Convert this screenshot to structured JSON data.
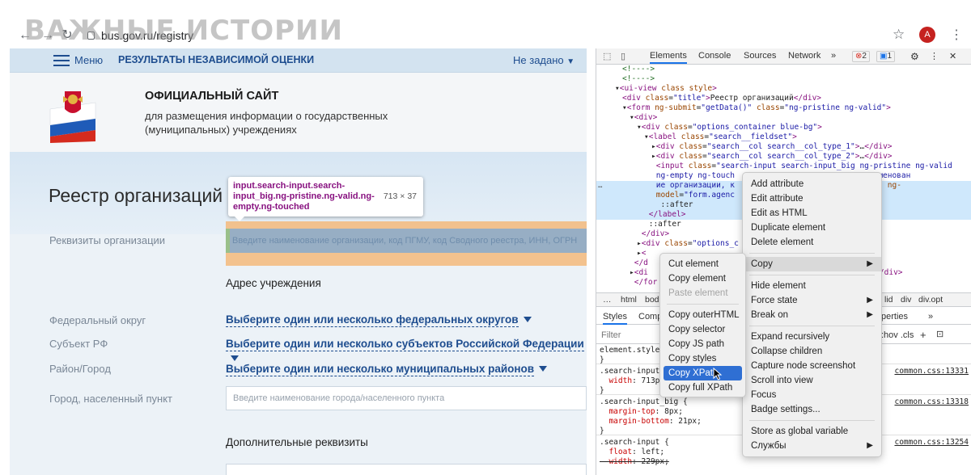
{
  "watermark": "ВАЖНЫЕ ИСТОРИИ",
  "browser": {
    "url": "bus.gov.ru/registry",
    "avatar_letter": "A"
  },
  "site": {
    "nav": {
      "menu_label": "Меню",
      "link": "РЕЗУЛЬТАТЫ НЕЗАВИСИМОЙ ОЦЕНКИ",
      "region": "Не задано"
    },
    "header": {
      "title": "ОФИЦИАЛЬНЫЙ САЙТ",
      "subtitle": "для размещения информации о государственных (муниципальных) учреждениях"
    },
    "page_title": "Реестр организаций",
    "form": {
      "requisites_label": "Реквизиты организации",
      "search_placeholder": "Введите наименование организации, код ПГМУ, код Сводного реестра, ИНН, ОГРН",
      "address_title": "Адрес учреждения",
      "district_label": "Федеральный округ",
      "district_value": "Выберите один или несколько федеральных округов",
      "subject_label": "Субъект РФ",
      "subject_value": "Выберите один или несколько субъектов Российской Федерации",
      "area_label": "Район/Город",
      "area_value": "Выберите один или несколько муниципальных районов",
      "city_label": "Город, населенный пункт",
      "city_placeholder": "Введите наименование города/населенного пункта",
      "extra_title": "Дополнительные реквизиты"
    },
    "tooltip": {
      "selector": "input.search-input.search-input_big.ng-pristine.ng-valid.ng-empty.ng-touched",
      "size": "713 × 37"
    }
  },
  "devtools": {
    "tabs": [
      "Elements",
      "Console",
      "Sources",
      "Network"
    ],
    "errors": "2",
    "messages": "1",
    "code_lines": [
      {
        "indent": 2,
        "html": "<span class='com'>&lt;!----&gt;</span>"
      },
      {
        "indent": 2,
        "html": "<span class='com'>&lt;!----&gt;</span>"
      },
      {
        "indent": 1,
        "html": "▾<span class='tag'>&lt;ui-view</span> <span class='attr'>class style</span><span class='tag'>&gt;</span>"
      },
      {
        "indent": 2,
        "html": "<span class='tag'>&lt;div</span> <span class='attr'>class</span>=<span class='val'>\"title\"</span><span class='tag'>&gt;</span>Реестр организаций<span class='tag'>&lt;/div&gt;</span>"
      },
      {
        "indent": 2,
        "html": "▾<span class='tag'>&lt;form</span> <span class='attr'>ng-submit</span>=<span class='val'>\"getData()\"</span> <span class='attr'>class</span>=<span class='val'>\"ng-pristine ng-valid\"</span><span class='tag'>&gt;</span>"
      },
      {
        "indent": 3,
        "html": "▾<span class='tag'>&lt;div&gt;</span>"
      },
      {
        "indent": 4,
        "html": "▾<span class='tag'>&lt;div</span> <span class='attr'>class</span>=<span class='val'>\"options_container blue-bg\"</span><span class='tag'>&gt;</span>"
      },
      {
        "indent": 5,
        "html": "▾<span class='tag'>&lt;label</span> <span class='attr'>class</span>=<span class='val'>\"search__fieldset\"</span><span class='tag'>&gt;</span>"
      },
      {
        "indent": 6,
        "html": "▸<span class='tag'>&lt;div</span> <span class='attr'>class</span>=<span class='val'>\"search__col search__col_type_1\"</span><span class='tag'>&gt;</span>…<span class='tag'>&lt;/div&gt;</span>"
      },
      {
        "indent": 6,
        "html": "▸<span class='tag'>&lt;div</span> <span class='attr'>class</span>=<span class='val'>\"search__col search__col_type_2\"</span><span class='tag'>&gt;</span>…<span class='tag'>&lt;/div&gt;</span>"
      },
      {
        "indent": 6,
        "html": " <span class='tag'>&lt;input</span> <span class='attr'>class</span>=<span class='val'>\"search-input search-input_big ng-pristine ng-valid</span>"
      },
      {
        "indent": 6,
        "html": " <span class='val'>ng-empty ng-touch</span>                       <span class='val'>дите наименован</span>"
      },
      {
        "indent": 6,
        "html": " <span class='val'>ие организации, к</span>                       <span class='val'>НН, ОГРН\"</span> <span class='attr'>ng-</span>"
      },
      {
        "indent": 6,
        "html": " <span class='attr'>model</span>=<span class='val'>\"form.agenc</span>"
      },
      {
        "indent": 6,
        "html": "  ::after"
      },
      {
        "indent": 5,
        "html": " <span class='tag'>&lt;/label&gt;</span>"
      },
      {
        "indent": 5,
        "html": " ::after"
      },
      {
        "indent": 4,
        "html": " <span class='tag'>&lt;/div&gt;</span>"
      },
      {
        "indent": 4,
        "html": "▸<span class='tag'>&lt;div</span> <span class='attr'>class</span>=<span class='val'>\"options_c</span>"
      },
      {
        "indent": 4,
        "html": "▸<span class='tag'>&lt;</span>"
      },
      {
        "indent": 3,
        "html": " <span class='tag'>&lt;/d</span>"
      },
      {
        "indent": 3,
        "html": "▸<span class='tag'>&lt;di</span>                                        <span class='val'>lue-bg\"</span><span class='tag'>&gt;</span>…<span class='tag'>&lt;/div&gt;</span>"
      },
      {
        "indent": 3,
        "html": " <span class='tag'>&lt;/for</span>"
      }
    ],
    "breadcrumbs": [
      "…",
      "html",
      "bod"
    ],
    "breadcrumbs_right": [
      "lid",
      "div",
      "div.opt"
    ],
    "subtabs": [
      "Styles",
      "Comp"
    ],
    "subtabs_right": "perties",
    "filter_placeholder": "Filter",
    "filter_tools": ":hov  .cls",
    "styles": [
      {
        "text": "element.style {",
        "src": ""
      },
      {
        "text": "}",
        "src": ""
      },
      {
        "text": ".search-input_",
        "src": "common.css:13331"
      },
      {
        "text": "  width: 713p",
        "src": ""
      },
      {
        "text": "}",
        "src": ""
      },
      {
        "text": ".search-input_big {",
        "src": "common.css:13318"
      },
      {
        "text": "  margin-top: 8px;",
        "src": ""
      },
      {
        "text": "  margin-bottom: 21px;",
        "src": ""
      },
      {
        "text": "}",
        "src": ""
      },
      {
        "text": ".search-input {",
        "src": "common.css:13254"
      },
      {
        "text": "  float: left;",
        "src": ""
      },
      {
        "text": "  width: 229px;",
        "src": ""
      }
    ]
  },
  "context_menu": {
    "items": [
      {
        "label": "Add attribute"
      },
      {
        "label": "Edit attribute"
      },
      {
        "label": "Edit as HTML"
      },
      {
        "label": "Duplicate element"
      },
      {
        "label": "Delete element"
      },
      {
        "sep": true
      },
      {
        "label": "Copy",
        "sub": true,
        "hover": true
      },
      {
        "sep": true
      },
      {
        "label": "Hide element"
      },
      {
        "label": "Force state",
        "sub": true
      },
      {
        "label": "Break on",
        "sub": true
      },
      {
        "sep": true
      },
      {
        "label": "Expand recursively"
      },
      {
        "label": "Collapse children"
      },
      {
        "label": "Capture node screenshot"
      },
      {
        "label": "Scroll into view"
      },
      {
        "label": "Focus"
      },
      {
        "label": "Badge settings..."
      },
      {
        "sep": true
      },
      {
        "label": "Store as global variable"
      },
      {
        "label": "Службы",
        "sub": true
      }
    ]
  },
  "copy_submenu": {
    "items": [
      {
        "label": "Cut element"
      },
      {
        "label": "Copy element"
      },
      {
        "label": "Paste element",
        "disabled": true
      },
      {
        "sep": true
      },
      {
        "label": "Copy outerHTML"
      },
      {
        "label": "Copy selector"
      },
      {
        "label": "Copy JS path"
      },
      {
        "label": "Copy styles"
      },
      {
        "label": "Copy XPath",
        "highlight": true
      },
      {
        "label": "Copy full XPath"
      }
    ]
  }
}
